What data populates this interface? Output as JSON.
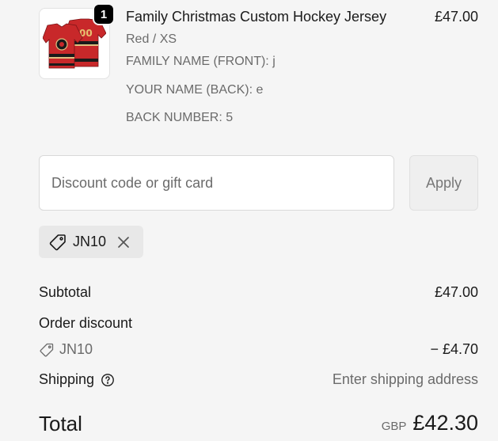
{
  "product": {
    "quantity": "1",
    "title": "Family Christmas Custom Hockey Jersey",
    "price": "£47.00",
    "variant": "Red / XS",
    "properties": [
      "FAMILY NAME (FRONT): j",
      "YOUR NAME (BACK): e",
      "BACK NUMBER: 5"
    ]
  },
  "discount": {
    "placeholder": "Discount code or gift card",
    "apply_label": "Apply",
    "applied_code": "JN10"
  },
  "summary": {
    "subtotal_label": "Subtotal",
    "subtotal_value": "£47.00",
    "order_discount_label": "Order discount",
    "discount_code": "JN10",
    "discount_value": "− £4.70",
    "shipping_label": "Shipping",
    "shipping_value": "Enter shipping address",
    "total_label": "Total",
    "currency": "GBP",
    "total_value": "£42.30"
  },
  "icons": {
    "tag": "tag-icon",
    "remove": "close-icon",
    "help": "help-circle-icon"
  },
  "colors": {
    "background": "#f5f5f5",
    "muted_text": "#6b6b6b",
    "jersey_red": "#c8282a"
  }
}
